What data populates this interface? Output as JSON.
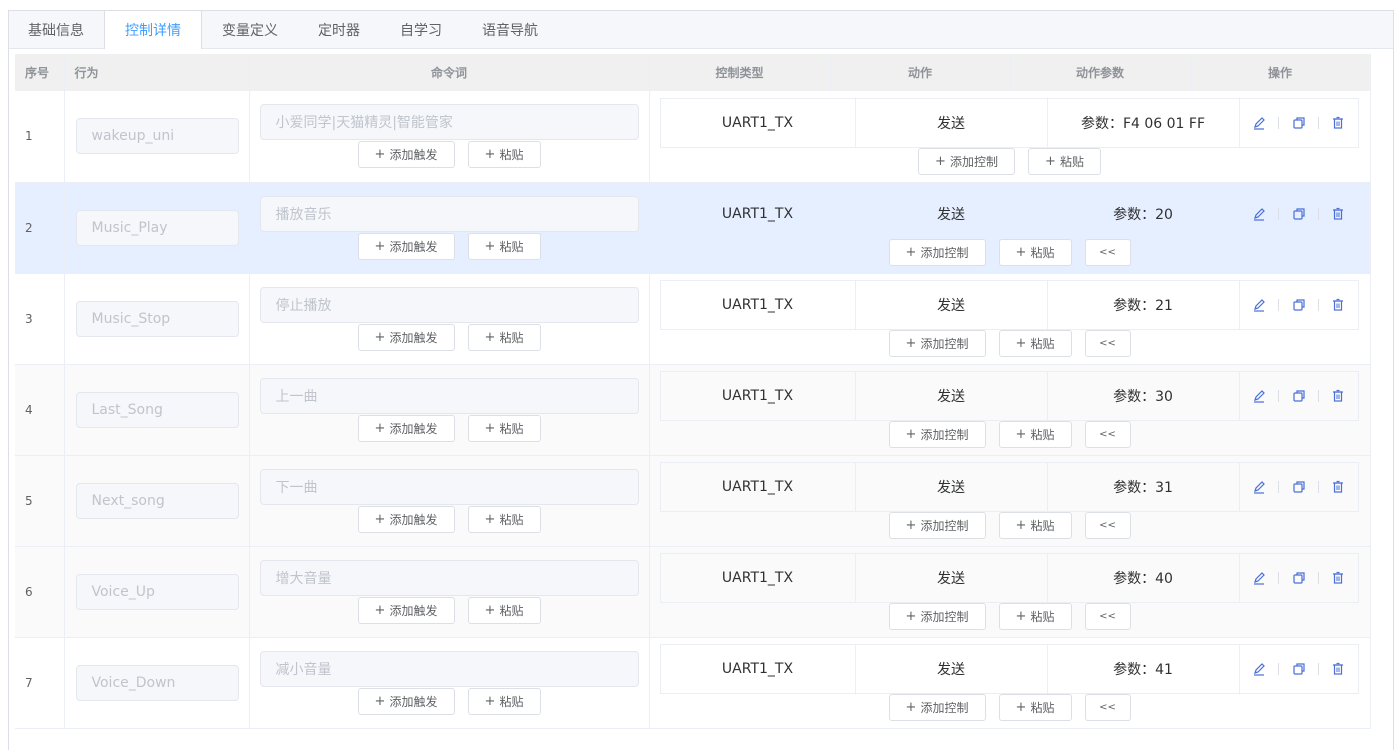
{
  "tabs": [
    {
      "label": "基础信息",
      "active": false
    },
    {
      "label": "控制详情",
      "active": true
    },
    {
      "label": "变量定义",
      "active": false
    },
    {
      "label": "定时器",
      "active": false
    },
    {
      "label": "自学习",
      "active": false
    },
    {
      "label": "语音导航",
      "active": false
    }
  ],
  "columns": {
    "no": "序号",
    "behavior": "行为",
    "command": "命令词",
    "control_type": "控制类型",
    "action": "动作",
    "action_params": "动作参数",
    "ops": "操作"
  },
  "buttons": {
    "add_trigger": "添加触发",
    "paste": "粘贴",
    "add_control": "添加控制",
    "collapse": "<<"
  },
  "rows": [
    {
      "no": "1",
      "behavior": "wakeup_uni",
      "command": "小爱同学|天猫精灵|智能管家",
      "control_type": "UART1_TX",
      "action": "发送",
      "param": "参数：F4 06 01 FF"
    },
    {
      "no": "2",
      "behavior": "Music_Play",
      "command": "播放音乐",
      "control_type": "UART1_TX",
      "action": "发送",
      "param": "参数：20"
    },
    {
      "no": "3",
      "behavior": "Music_Stop",
      "command": "停止播放",
      "control_type": "UART1_TX",
      "action": "发送",
      "param": "参数：21"
    },
    {
      "no": "4",
      "behavior": "Last_Song",
      "command": "上一曲",
      "control_type": "UART1_TX",
      "action": "发送",
      "param": "参数：30"
    },
    {
      "no": "5",
      "behavior": "Next_song",
      "command": "下一曲",
      "control_type": "UART1_TX",
      "action": "发送",
      "param": "参数：31"
    },
    {
      "no": "6",
      "behavior": "Voice_Up",
      "command": "增大音量",
      "control_type": "UART1_TX",
      "action": "发送",
      "param": "参数：40"
    },
    {
      "no": "7",
      "behavior": "Voice_Down",
      "command": "减小音量",
      "control_type": "UART1_TX",
      "action": "发送",
      "param": "参数：41"
    }
  ],
  "colors": {
    "accent": "#409eff",
    "highlight_row": "#e6efff",
    "icon": "#4a6fd6"
  }
}
